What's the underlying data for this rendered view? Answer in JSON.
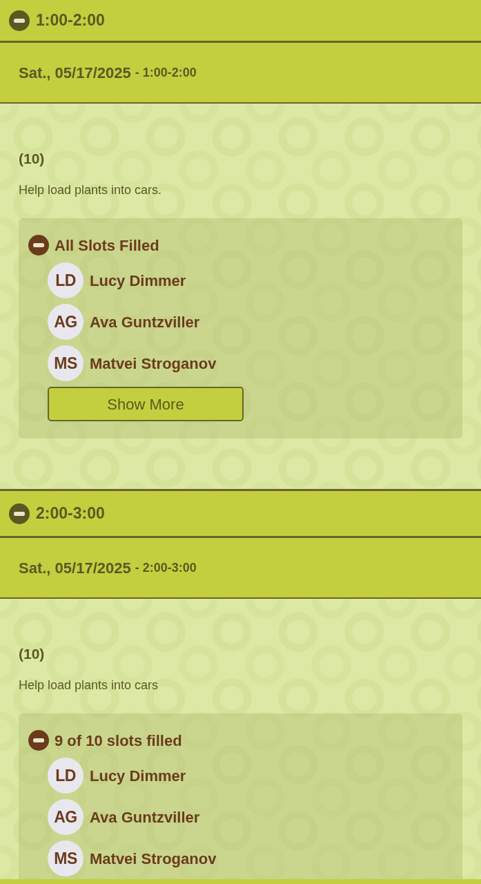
{
  "sections": [
    {
      "expanded": true,
      "title": "1:00-2:00",
      "date": "Sat., 05/17/2025",
      "time": "- 1:00-2:00",
      "count": "(10)",
      "description": "Help load plants into cars.",
      "slots": {
        "expanded": true,
        "heading": "All Slots Filled",
        "people": [
          {
            "initials": "LD",
            "name": "Lucy Dimmer"
          },
          {
            "initials": "AG",
            "name": "Ava Guntzviller"
          },
          {
            "initials": "MS",
            "name": "Matvei Stroganov"
          }
        ],
        "button": "Show More"
      }
    },
    {
      "expanded": true,
      "title": "2:00-3:00",
      "date": "Sat., 05/17/2025",
      "time": "- 2:00-3:00",
      "count": "(10)",
      "description": "Help load plants into cars",
      "slots": {
        "expanded": true,
        "heading": "9 of 10 slots filled",
        "people": [
          {
            "initials": "LD",
            "name": "Lucy Dimmer"
          },
          {
            "initials": "AG",
            "name": "Ava Guntzviller"
          },
          {
            "initials": "MS",
            "name": "Matvei Stroganov"
          }
        ]
      }
    }
  ]
}
